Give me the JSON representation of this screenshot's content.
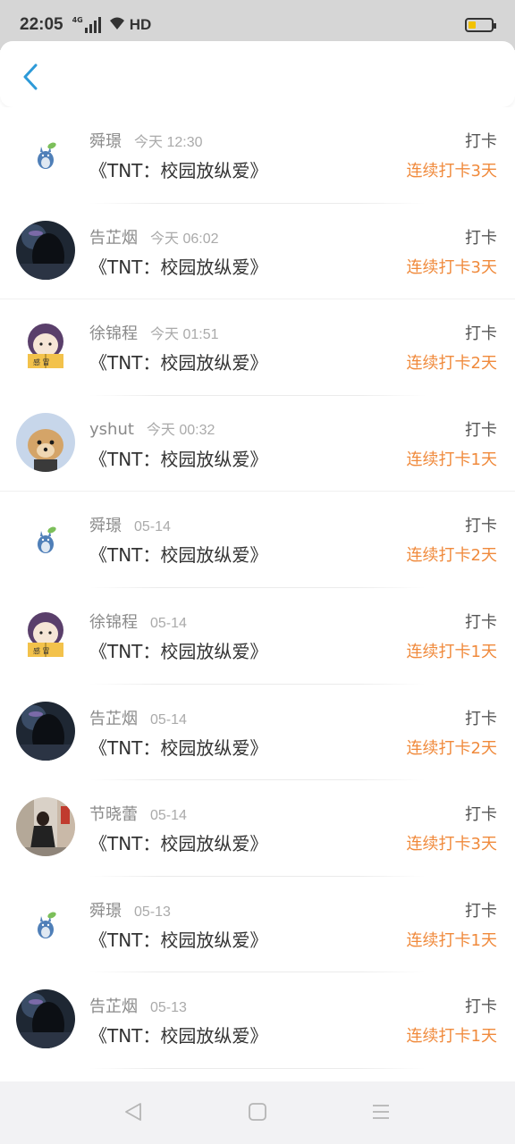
{
  "status_bar": {
    "time": "22:05",
    "network": "4G",
    "hd": "HD"
  },
  "colors": {
    "accent": "#2d9ad8",
    "streak": "#f08a3c"
  },
  "rows": [
    {
      "name": "舜璟",
      "time": "今天 12:30",
      "book": "《TNT：校园放纵爱》",
      "action": "打卡",
      "streak": "连续打卡3天",
      "avatar": "totoro"
    },
    {
      "name": "告芷烟",
      "time": "今天 06:02",
      "book": "《TNT：校园放纵爱》",
      "action": "打卡",
      "streak": "连续打卡3天",
      "avatar": "dark-girl"
    },
    {
      "name": "徐锦程",
      "time": "今天 01:51",
      "book": "《TNT：校园放纵爱》",
      "action": "打卡",
      "streak": "连续打卡2天",
      "avatar": "cartoon-reader"
    },
    {
      "name": "yshut",
      "time": "今天 00:32",
      "book": "《TNT：校园放纵爱》",
      "action": "打卡",
      "streak": "连续打卡1天",
      "avatar": "dog"
    },
    {
      "name": "舜璟",
      "time": "05-14",
      "book": "《TNT：校园放纵爱》",
      "action": "打卡",
      "streak": "连续打卡2天",
      "avatar": "totoro"
    },
    {
      "name": "徐锦程",
      "time": "05-14",
      "book": "《TNT：校园放纵爱》",
      "action": "打卡",
      "streak": "连续打卡1天",
      "avatar": "cartoon-reader"
    },
    {
      "name": "告芷烟",
      "time": "05-14",
      "book": "《TNT：校园放纵爱》",
      "action": "打卡",
      "streak": "连续打卡2天",
      "avatar": "dark-girl"
    },
    {
      "name": "节晓蕾",
      "time": "05-14",
      "book": "《TNT：校园放纵爱》",
      "action": "打卡",
      "streak": "连续打卡3天",
      "avatar": "photo-girl"
    },
    {
      "name": "舜璟",
      "time": "05-13",
      "book": "《TNT：校园放纵爱》",
      "action": "打卡",
      "streak": "连续打卡1天",
      "avatar": "totoro"
    },
    {
      "name": "告芷烟",
      "time": "05-13",
      "book": "《TNT：校园放纵爱》",
      "action": "打卡",
      "streak": "连续打卡1天",
      "avatar": "dark-girl"
    }
  ],
  "nav": {
    "back": "back-triangle-icon",
    "home": "square-home-icon",
    "menu": "menu-lines-icon"
  }
}
